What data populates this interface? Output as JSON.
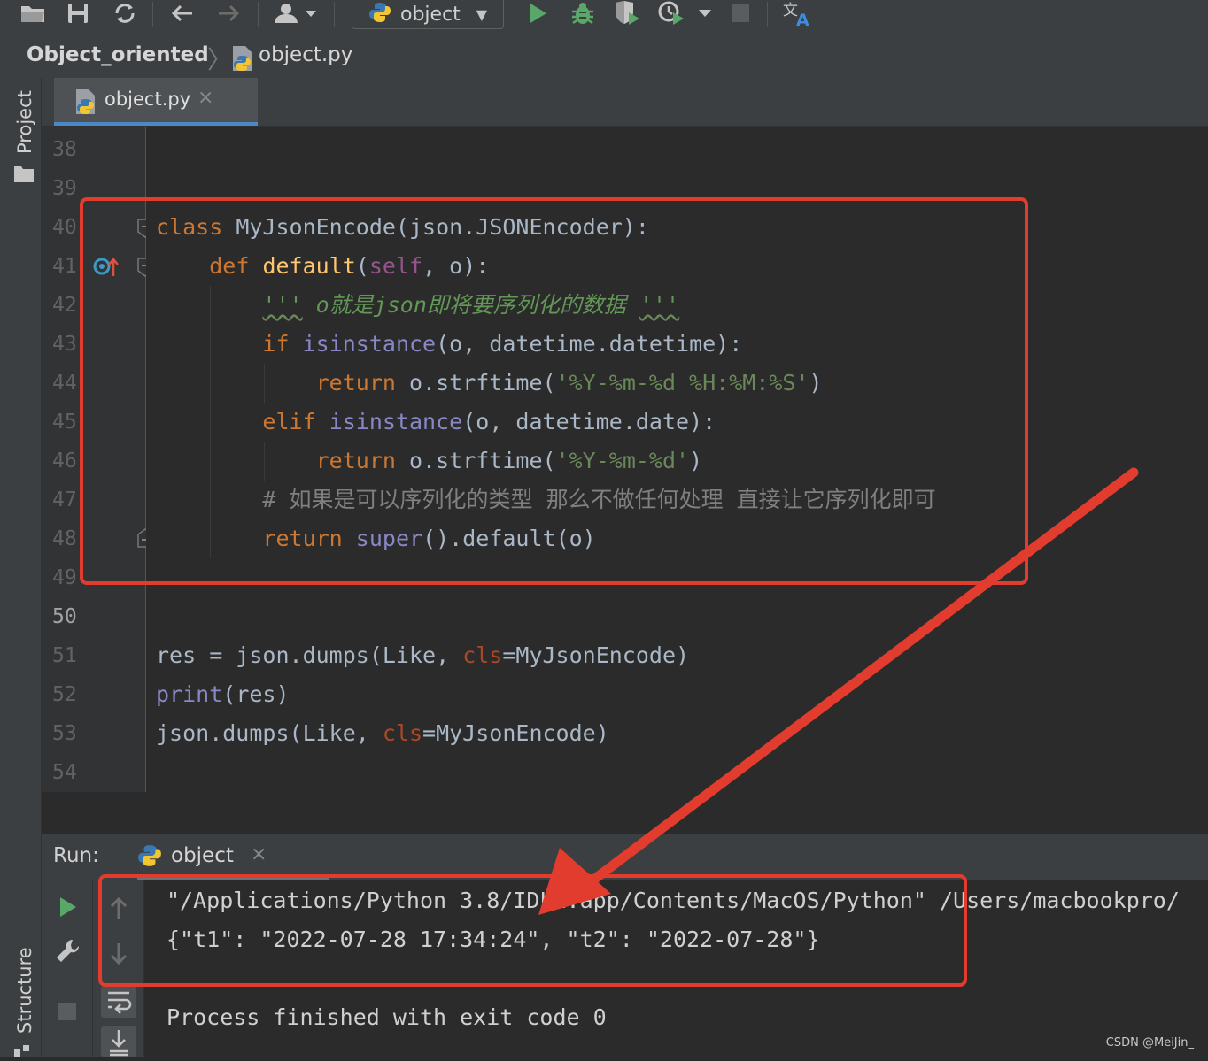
{
  "toolbar": {
    "run_config_label": "object"
  },
  "breadcrumb": {
    "project": "Object_oriented",
    "file": "object.py"
  },
  "left_strip": {
    "project_label": "Project",
    "structure_label": "Structure"
  },
  "editor_tab": {
    "label": "object.py",
    "close": "×"
  },
  "editor": {
    "line_numbers": [
      "38",
      "39",
      "40",
      "41",
      "42",
      "43",
      "44",
      "45",
      "46",
      "47",
      "48",
      "49",
      "50",
      "51",
      "52",
      "53",
      "54"
    ],
    "current_line": "50"
  },
  "run_panel": {
    "label": "Run:",
    "tab_label": "object",
    "close": "×",
    "output": [
      "\"/Applications/Python 3.8/IDLE.app/Contents/MacOS/Python\" /Users/macbookpro/",
      "{\"t1\": \"2022-07-28 17:34:24\", \"t2\": \"2022-07-28\"}",
      "",
      "Process finished with exit code 0"
    ]
  },
  "watermark": "CSDN @MeiJin_",
  "colors": {
    "annotation_red": "#e23c2e",
    "run_green": "#59a869",
    "tab_underline": "#4a88c7"
  }
}
